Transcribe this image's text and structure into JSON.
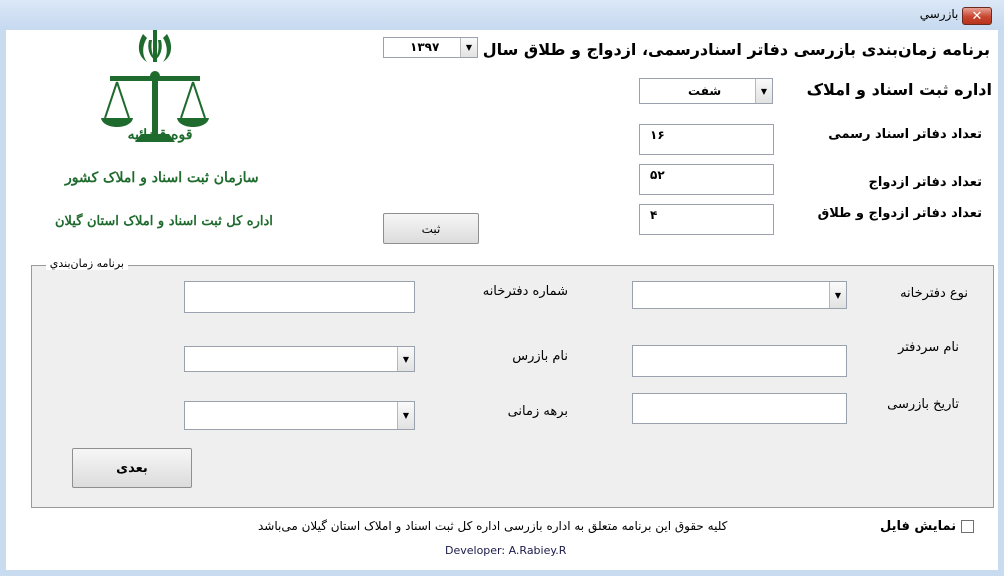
{
  "window": {
    "title": "برنامه بازرسي",
    "close_glyph": "✕"
  },
  "header": {
    "main_title": "برنامه زمان‌بندی بازرسی دفاتر اسنادرسمی، ازدواج و طلاق سال",
    "year_value": "۱۳۹۷",
    "office_title": "اداره ثبت اسناد و املاک",
    "office_value": "شفت"
  },
  "logo": {
    "line1": "قوه قضائیه",
    "line2": "سازمان ثبت اسناد و املاک کشور",
    "line3": "اداره کل ثبت اسناد و املاک استان گیلان",
    "color": "#1f6b2e"
  },
  "counts": [
    {
      "label": "تعداد دفاتر اسناد رسمی",
      "value": "۱۶"
    },
    {
      "label": "تعداد دفاتر ازدواج",
      "value": "۵۲"
    },
    {
      "label": "تعداد دفاتر ازدواج و طلاق",
      "value": "۴"
    }
  ],
  "register_button": "ثبت",
  "schedule": {
    "caption": "برنامه زمان‌بندي",
    "office_type_label": "نوع دفترخانه",
    "office_number_label": "شماره دفترخانه",
    "notary_name_label": "نام سردفتر",
    "inspector_name_label": "نام بازرس",
    "inspection_date_label": "تاریخ بازرسی",
    "time_period_label": "برهه زمانی",
    "next_button": "بعدی"
  },
  "footer": {
    "rights": "کلیه حقوق این برنامه متعلق به اداره بازرسی اداره کل ثبت اسناد و املاک استان گیلان می‌باشد",
    "developer": "Developer: A.Rabiey.R",
    "show_file_label": "نمایش فایل"
  },
  "icons": {
    "dropdown": "chevron-down-icon",
    "emblem": "scales-of-justice-icon"
  }
}
